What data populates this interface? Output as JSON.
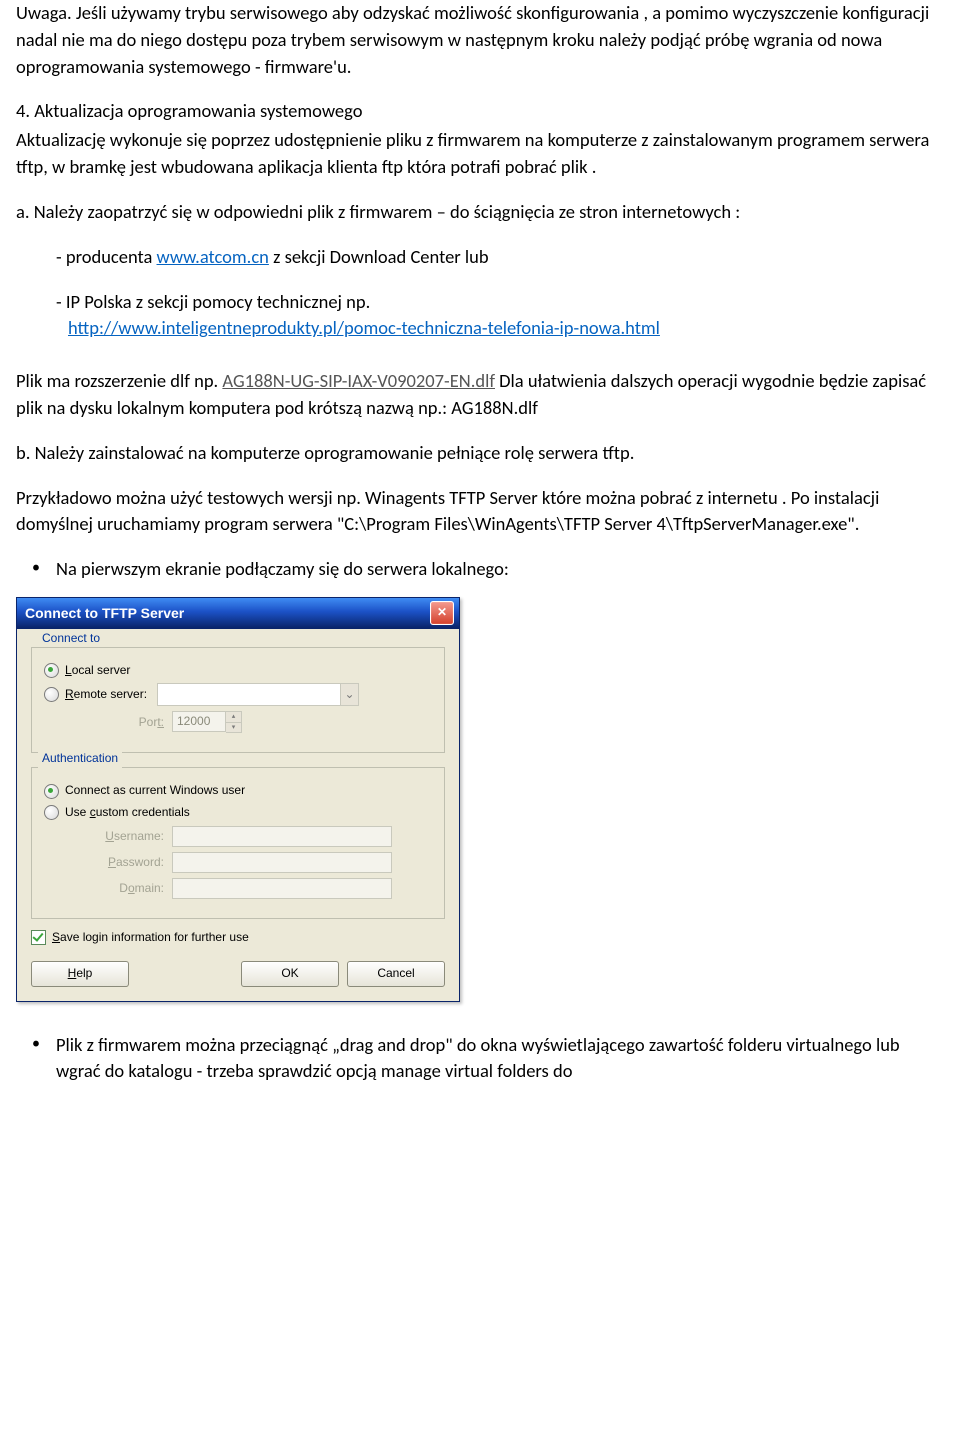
{
  "doc": {
    "p1": "Uwaga. Jeśli używamy trybu serwisowego aby odzyskać  możliwość skonfigurowania , a pomimo wyczyszczenie konfiguracji nadal nie ma do niego dostępu poza trybem serwisowym w następnym kroku należy podjąć próbę wgrania od nowa oprogramowania systemowego  - firmware'u.",
    "p2": "4. Aktualizacja oprogramowania systemowego",
    "p3": "Aktualizację wykonuje się poprzez udostępnienie pliku z firmwarem na komputerze z zainstalowanym programem serwera tftp, w bramkę jest wbudowana aplikacja klienta ftp która potrafi pobrać plik .",
    "p4": "a. Należy zaopatrzyć się w odpowiedni plik z firmwarem – do ściągnięcia ze stron internetowych :",
    "p5a": "-  producenta ",
    "p5b": "  z sekcji Download Center lub",
    "p6a": "- IP Polska z sekcji pomocy technicznej np.",
    "p8a": "Plik ma rozszerzenie dlf np. ",
    "p8b": "  Dla ułatwienia dalszych operacji wygodnie będzie zapisać plik na dysku lokalnym komputera pod krótszą nazwą np.:  AG188N.dlf",
    "p9": "b. Należy zainstalować na komputerze oprogramowanie pełniące rolę serwera tftp.",
    "p10": "Przykładowo można użyć  testowych wersji np. Winagents TFTP Server które można pobrać z internetu . Po instalacji domyślnej uruchamiamy program  serwera \"C:\\Program Files\\WinAgents\\TFTP Server 4\\TftpServerManager.exe\".",
    "b1": "Na pierwszym ekranie podłączamy się do serwera lokalnego:",
    "b2": "Plik z firmwarem można przeciągnąć „drag and drop\" do okna wyświetlającego zawartość folderu virtualnego lub wgrać do katalogu - trzeba sprawdzić opcją manage virtual folders do",
    "links": {
      "atcom": "www.atcom.cn",
      "ipnowa": "http://www.inteligentneprodukty.pl/pomoc-techniczna-telefonia-ip-nowa.html",
      "dlf": "AG188N-UG-SIP-IAX-V090207-EN.dlf"
    }
  },
  "dialog": {
    "title": "Connect to TFTP Server",
    "connect_to_legend": "Connect to",
    "local_label_pre": "L",
    "local_label_post": "ocal server",
    "remote_label_pre": "R",
    "remote_label_post": "emote server:",
    "port_label_pre": "Por",
    "port_label_post": "t:",
    "port_value": "12000",
    "auth_legend": "Authentication",
    "auth1": "Connect as current Windows user",
    "auth2_pre": "Use ",
    "auth2_u": "c",
    "auth2_post": "ustom credentials",
    "user_pre": "U",
    "user_post": "sername:",
    "pass_pre": "P",
    "pass_post": "assword:",
    "domain_pre": "D",
    "domain_u": "o",
    "domain_post": "main:",
    "save_pre": "S",
    "save_post": "ave login information for further use",
    "help_pre": "H",
    "help_post": "elp",
    "ok": "OK",
    "cancel": "Cancel"
  }
}
